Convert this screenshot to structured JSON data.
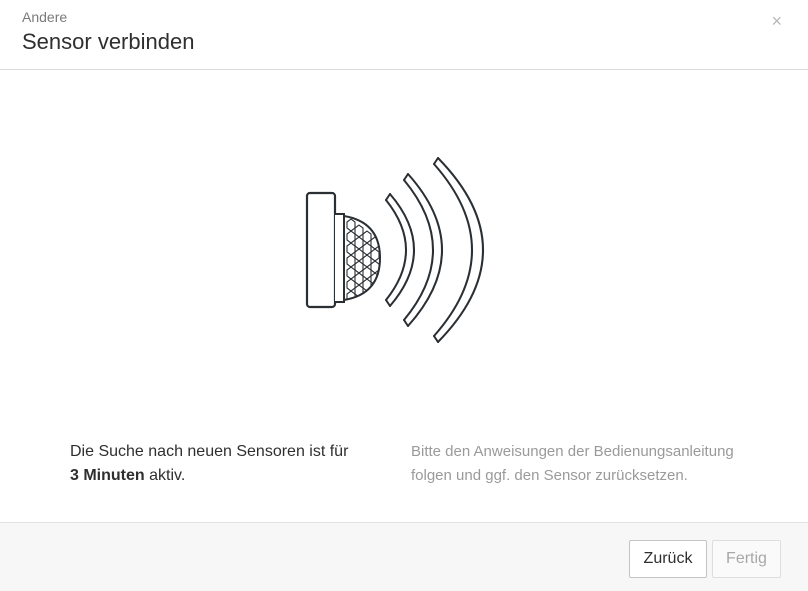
{
  "header": {
    "subtitle": "Andere",
    "title": "Sensor verbinden",
    "close_symbol": "×"
  },
  "illustration": {
    "icon": "motion-sensor-with-signal-waves-icon"
  },
  "info": {
    "left_line1": "Die Suche nach neuen Sensoren ist für",
    "left_bold": "3 Minuten",
    "left_after_bold": " aktiv.",
    "right_text": "Bitte den Anweisungen der Bedienungsanleitung folgen und ggf. den Sensor zurücksetzen."
  },
  "footer": {
    "back_label": "Zurück",
    "done_label": "Fertig"
  },
  "colors": {
    "text_primary": "#2f2f2f",
    "text_secondary": "#9a9a9a",
    "border": "#dcdcdc",
    "footer_bg": "#f7f7f7"
  }
}
